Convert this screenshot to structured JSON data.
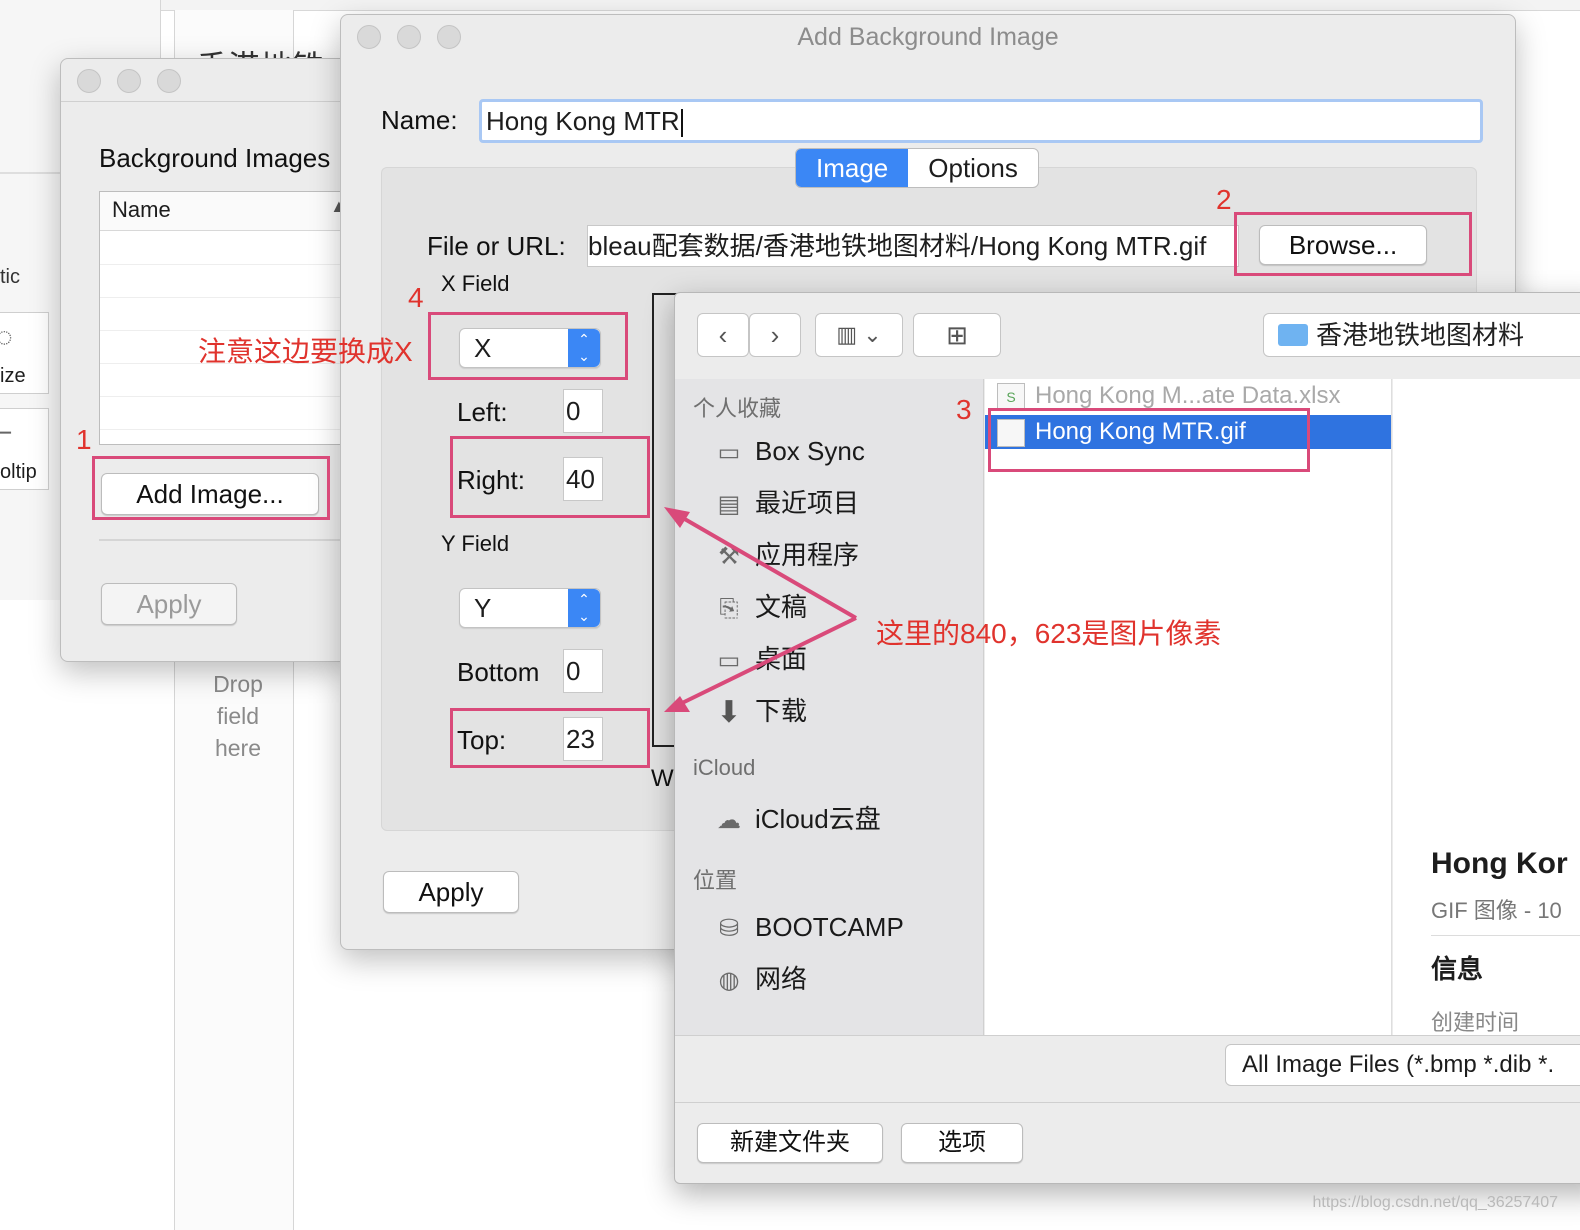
{
  "background_app": {
    "heading": "香港地铁",
    "left_items": [
      "tic",
      "ize",
      "oltip"
    ],
    "drop_text": [
      "Drop",
      "field",
      "here"
    ]
  },
  "bg_images_window": {
    "title": "Background Images",
    "table_header": "Name",
    "add_button": "Add Image...",
    "apply_button": "Apply"
  },
  "add_window": {
    "title": "Add Background Image",
    "name_label": "Name:",
    "name_value": "Hong Kong MTR",
    "tabs": [
      "Image",
      "Options"
    ],
    "active_tab": "Image",
    "file_label": "File or URL:",
    "file_value": "bleau配套数据/香港地铁地图材料/Hong Kong MTR.gif",
    "browse_button": "Browse...",
    "x_field_label": "X Field",
    "x_select": "X",
    "left_label": "Left:",
    "left_value": "0",
    "right_label": "Right:",
    "right_value": "40",
    "y_field_label": "Y Field",
    "y_select": "Y",
    "bottom_label": "Bottom",
    "bottom_value": "0",
    "top_label": "Top:",
    "top_value": "23",
    "apply_button": "Apply",
    "partial_text": "W"
  },
  "finder": {
    "toolbar": {
      "back": "‹",
      "forward": "›",
      "view": "▥ ⌄",
      "new_folder": "⊞",
      "location": "香港地铁地图材料"
    },
    "sidebar": {
      "favorites_header": "个人收藏",
      "favorites": [
        "Box Sync",
        "最近项目",
        "应用程序",
        "文稿",
        "桌面",
        "下载"
      ],
      "icloud_header": "iCloud",
      "icloud": [
        "iCloud云盘"
      ],
      "locations_header": "位置",
      "locations": [
        "BOOTCAMP",
        "网络"
      ]
    },
    "files": [
      {
        "name": "Hong Kong M...ate Data.xlsx",
        "selected": false
      },
      {
        "name": "Hong Kong MTR.gif",
        "selected": true
      }
    ],
    "preview": {
      "title": "Hong Kor",
      "subtitle": "GIF 图像 - 10",
      "info_header": "信息",
      "created_label": "创建时间"
    },
    "filter": "All Image Files (*.bmp *.dib *.",
    "new_folder_button": "新建文件夹",
    "options_button": "选项"
  },
  "annotations": {
    "step1": "1",
    "step2": "2",
    "step3": "3",
    "step4": "4",
    "change_to_x": "注意这边要换成X",
    "pixels_note": "这里的840，623是图片像素"
  },
  "colors": {
    "highlight": "#d94a7a",
    "annotation_text": "#e0332d",
    "accent": "#3b87f5",
    "selection": "#2f73e0"
  },
  "watermark": "https://blog.csdn.net/qq_36257407"
}
